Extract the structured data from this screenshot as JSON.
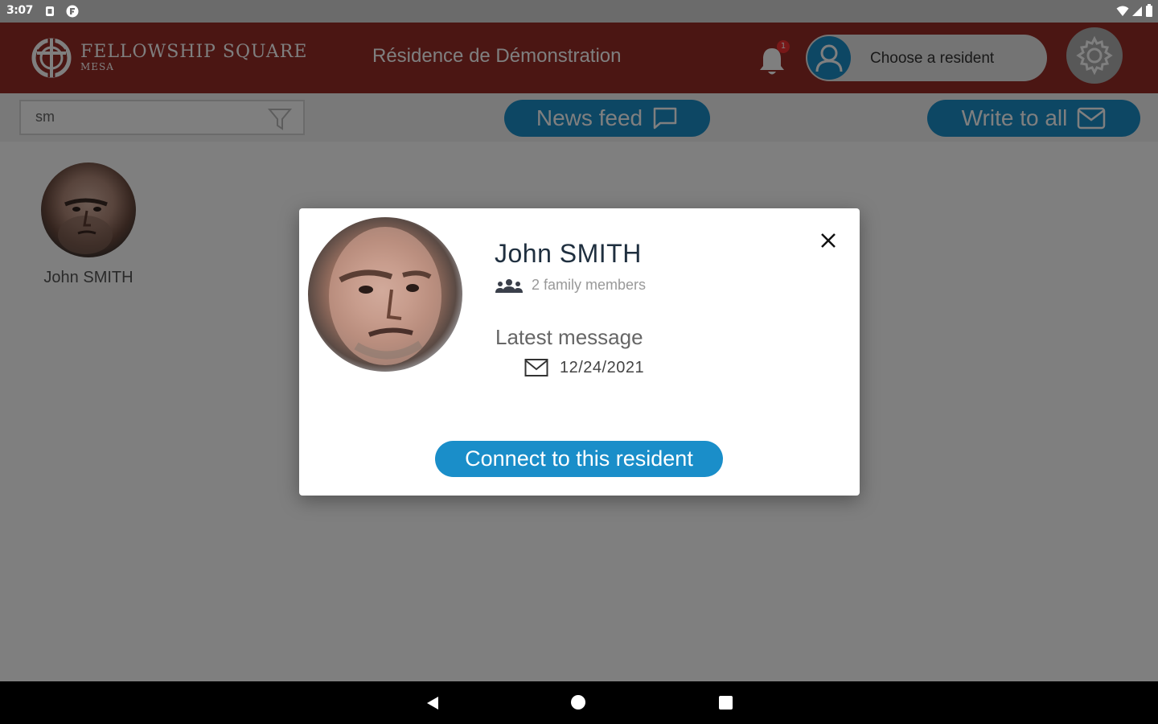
{
  "status_bar": {
    "time": "3:07"
  },
  "header": {
    "logo_main": "FELLOWSHIP SQUARE",
    "logo_sub": "MESA",
    "residence_title": "Résidence de Démonstration",
    "notification_count": "1",
    "resident_chooser_label": "Choose a resident"
  },
  "toolbar": {
    "search_value": "sm",
    "news_feed_label": "News feed",
    "write_to_all_label": "Write to all"
  },
  "residents": [
    {
      "name": "John SMITH"
    }
  ],
  "modal": {
    "name": "John SMITH",
    "family_members": "2 family members",
    "latest_message_label": "Latest message",
    "latest_message_date": "12/24/2021",
    "connect_label": "Connect to this resident"
  },
  "colors": {
    "header_red": "#962c26",
    "accent_blue": "#1a8ec9",
    "overlay": "rgba(0,0,0,0.5)"
  }
}
